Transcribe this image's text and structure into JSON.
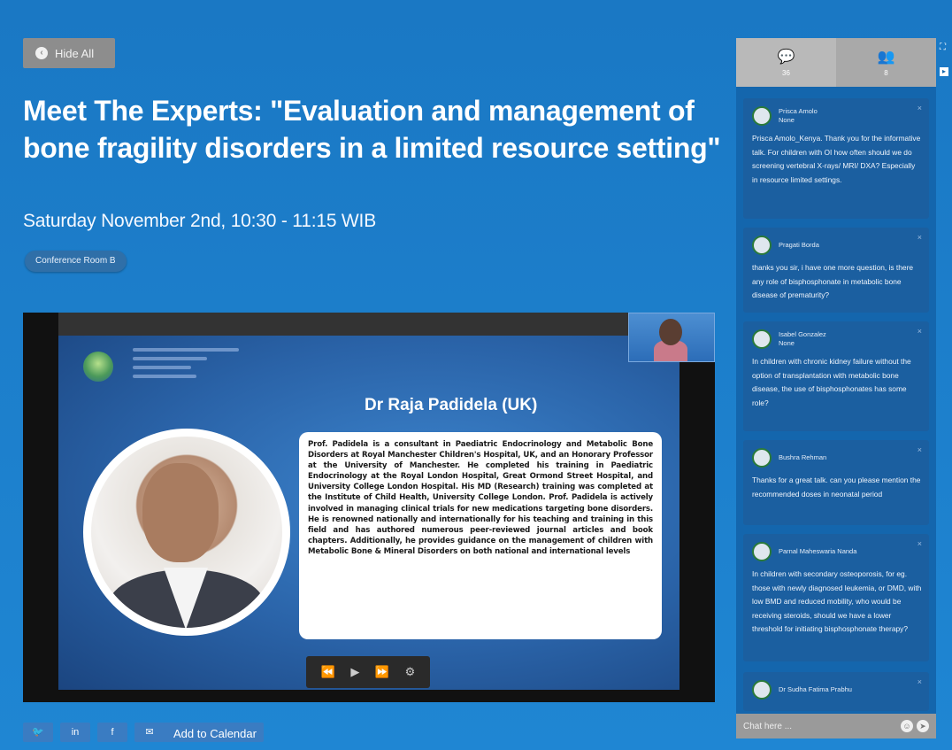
{
  "hide_all": "Hide All",
  "title": "Meet The Experts: \"Evaluation and management of bone fragility disorders in a limited resource setting\"",
  "datetime": "Saturday November 2nd, 10:30 - 11:15 WIB",
  "room": "Conference Room B",
  "slide": {
    "name": "Dr Raja Padidela (UK)",
    "bio": "Prof. Padidela is a consultant in Paediatric Endocrinology and Metabolic Bone Disorders at Royal Manchester Children's Hospital, UK, and an Honorary Professor at the University of Manchester. He completed his training in Paediatric Endocrinology at the Royal London Hospital, Great Ormond Street Hospital, and University College London Hospital. His MD (Research) training was completed at the Institute of Child Health, University College London. Prof. Padidela is actively involved in managing clinical trials for new medications targeting bone disorders. He is renowned nationally and internationally for his teaching and training in this field and has authored numerous peer-reviewed journal articles and book chapters. Additionally, he provides guidance on the management of children with Metabolic Bone & Mineral Disorders on both national and international levels"
  },
  "video_controls": [
    "⏪",
    "▶",
    "⏩",
    "⚙"
  ],
  "share_buttons": [
    "🐦",
    "in",
    "f",
    "✉"
  ],
  "add_calendar": "Add to Calendar",
  "tabs": [
    {
      "icon": "chat-icon",
      "glyph": "💬",
      "count": "36"
    },
    {
      "icon": "people-icon",
      "glyph": "👥",
      "count": "8"
    }
  ],
  "messages": [
    {
      "name": "Prisca Amolo",
      "sub": "None",
      "text": "Prisca Amolo_Kenya. Thank you for the informative talk. For children with OI how often should we do screening vertebral X-rays/ MRI/ DXA? Especially in resource limited settings."
    },
    {
      "name": "Pragati Borda",
      "sub": "",
      "text": "thanks you sir, i have one more question, is there any role of bisphosphonate in metabolic bone disease of prematurity?"
    },
    {
      "name": "Isabel Gonzalez",
      "sub": "None",
      "text": "In children with chronic kidney failure without the option of transplantation with metabolic bone disease, the use of bisphosphonates has some role?"
    },
    {
      "name": "Bushra Rehman",
      "sub": "",
      "text": "Thanks for a great talk. can you please mention the recommended doses in neonatal period"
    },
    {
      "name": "Parnal Maheswaria Nanda",
      "sub": "",
      "text": "In children with secondary osteoporosis, for eg. those with newly diagnosed leukemia, or DMD, with low BMD and reduced mobility, who would be receiving steroids, should we have a lower threshold for initiating bisphosphonate therapy?"
    },
    {
      "name": "Dr Sudha Fatima Prabhu",
      "sub": "",
      "text": ""
    }
  ],
  "chat_placeholder": "Chat here ...",
  "colors": {
    "background": "#1d7fcc",
    "panel": "#1466ad",
    "tab": "#a9a9a9"
  }
}
